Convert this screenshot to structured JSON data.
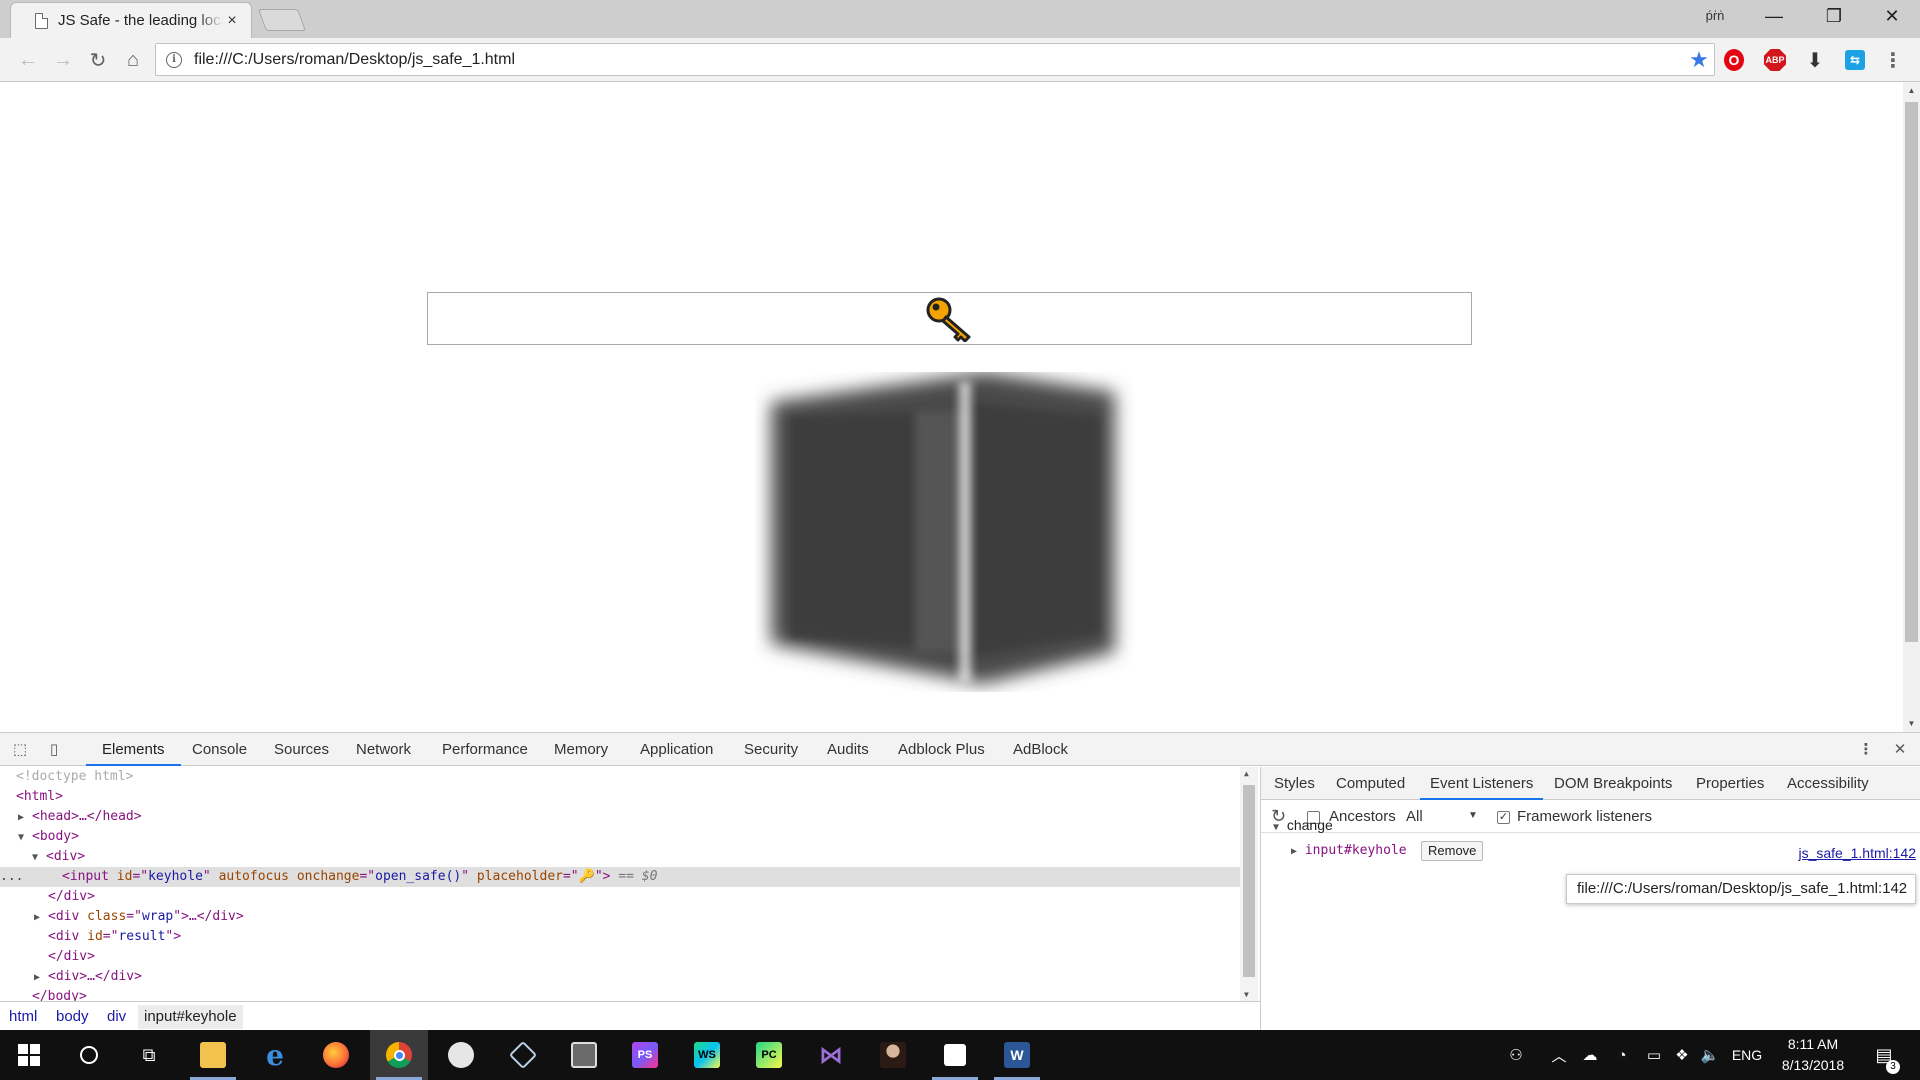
{
  "browser": {
    "tab_title": "JS Safe - the leading local",
    "tab_close": "×",
    "profile_label": "ṕṙṅ",
    "window_controls": {
      "minimize": "—",
      "restore": "❐",
      "close": "✕"
    },
    "nav": {
      "back": "←",
      "forward": "→",
      "reload": "↻",
      "home": "⌂"
    },
    "url": "file:///C:/Users/roman/Desktop/js_safe_1.html",
    "star": "★",
    "extensions": {
      "opera": "O",
      "abp": "ABP",
      "download": "⬇",
      "translate": "⇆",
      "menu": "⋮"
    }
  },
  "page": {
    "keyhole_placeholder": "🔑",
    "keyhole_icon": "key-icon",
    "key_color": "#e69b00"
  },
  "devtools": {
    "tabs": [
      "Elements",
      "Console",
      "Sources",
      "Network",
      "Performance",
      "Memory",
      "Application",
      "Security",
      "Audits",
      "Adblock Plus",
      "AdBlock"
    ],
    "active_tab": "Elements",
    "more_menu": "⋮",
    "close": "✕",
    "dom": {
      "doctype": "<!doctype html>",
      "html_open": "<html>",
      "head": "<head>…</head>",
      "body_open": "<body>",
      "div_open": "<div>",
      "input_tag": "input",
      "input_id_name": "id",
      "input_id_value": "keyhole",
      "input_autofocus": "autofocus",
      "input_onchange_name": "onchange",
      "input_onchange_value": "open_safe()",
      "input_placeholder_name": "placeholder",
      "input_placeholder_value": "🔑",
      "selected_marker": "== $0",
      "div_close": "</div>",
      "wrap_div_class_name": "class",
      "wrap_div_class_value": "wrap",
      "result_div_id_name": "id",
      "result_div_id_value": "result",
      "collapsed_div": "<div>…</div>",
      "body_close": "</body>",
      "ellipsis_marker": "..."
    },
    "breadcrumbs": [
      "html",
      "body",
      "div",
      "input#keyhole"
    ],
    "sidebar": {
      "tabs": [
        "Styles",
        "Computed",
        "Event Listeners",
        "DOM Breakpoints",
        "Properties",
        "Accessibility"
      ],
      "active_tab": "Event Listeners",
      "refresh": "↻",
      "ancestors_label": "Ancestors",
      "ancestors_checked": false,
      "filter_value": "All",
      "filter_arrow": "▼",
      "framework_label": "Framework listeners",
      "framework_checked": true,
      "event_name": "change",
      "listener_target": "input#keyhole",
      "remove_label": "Remove",
      "source_link": "js_safe_1.html:142",
      "tooltip": "file:///C:/Users/roman/Desktop/js_safe_1.html:142"
    }
  },
  "taskbar": {
    "clock_time": "8:11 AM",
    "clock_date": "8/13/2018",
    "language": "ENG",
    "notifications_count": "3",
    "apps": [
      "file-explorer",
      "edge",
      "firefox",
      "chrome",
      "paint",
      "virtualbox",
      "photo-viewer",
      "phpstorm",
      "webstorm",
      "pycharm",
      "visual-studio",
      "photo",
      "sticky-notes",
      "word"
    ],
    "app_labels": {
      "phpstorm": "PS",
      "webstorm": "WS",
      "pycharm": "PC",
      "word": "W",
      "edge": "e"
    }
  },
  "colors": {
    "accent": "#1a73e8",
    "star": "#3b78e7",
    "tag": "#881280",
    "attr_name": "#994500",
    "attr_value": "#1a1aa6"
  }
}
